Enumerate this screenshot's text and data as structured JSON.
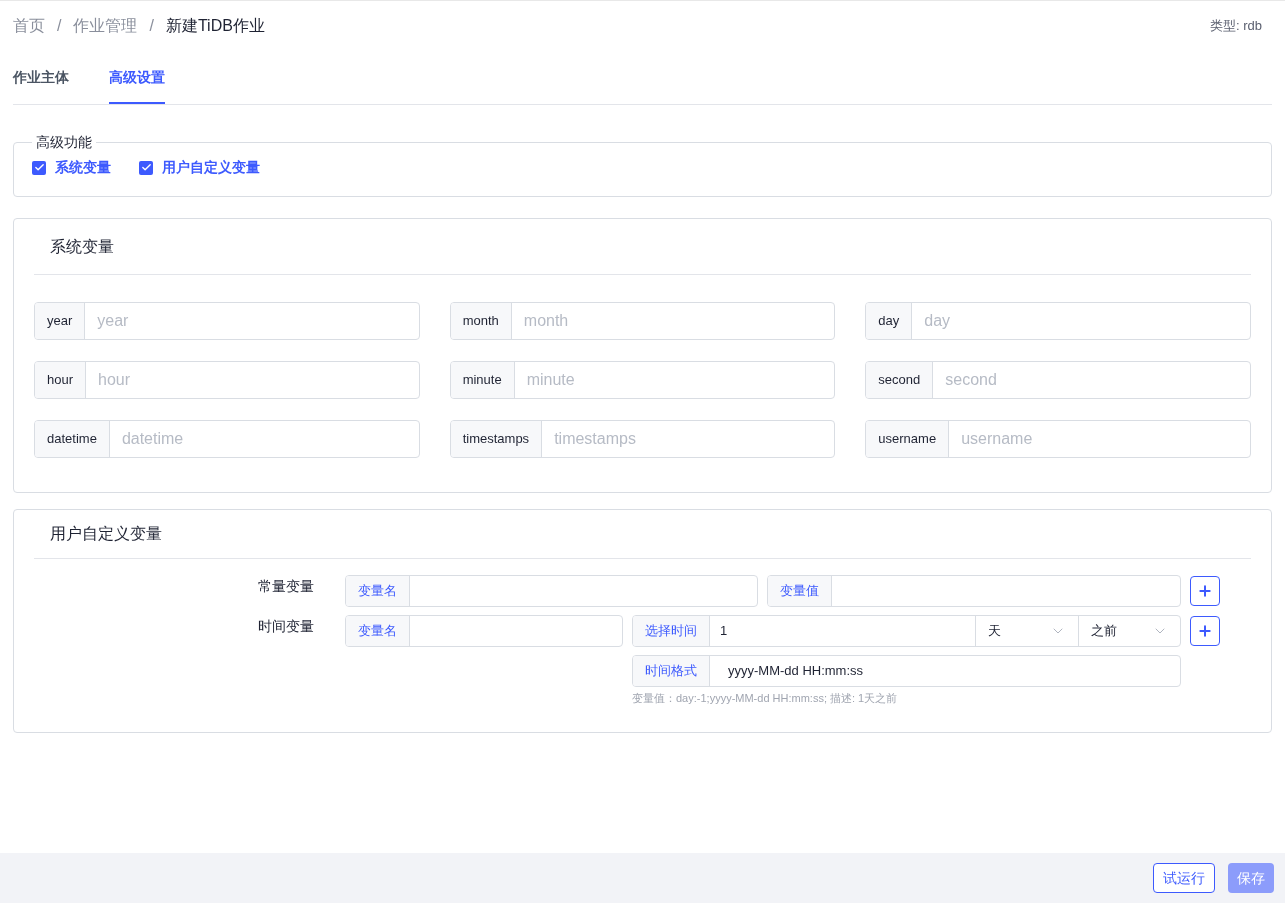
{
  "breadcrumb": [
    {
      "label": "首页",
      "current": false
    },
    {
      "label": "作业管理",
      "current": false
    },
    {
      "label": "新建TiDB作业",
      "current": true
    }
  ],
  "breadcrumb_separator": "/",
  "type_label": "类型: rdb",
  "tabs": [
    {
      "label": "作业主体",
      "selected": false
    },
    {
      "label": "高级设置",
      "selected": true
    }
  ],
  "advanced": {
    "legend": "高级功能",
    "options": [
      {
        "label": "系统变量",
        "checked": true
      },
      {
        "label": "用户自定义变量",
        "checked": true
      }
    ]
  },
  "system_vars": {
    "title": "系统变量",
    "fields": [
      {
        "label": "year",
        "placeholder": "year"
      },
      {
        "label": "month",
        "placeholder": "month"
      },
      {
        "label": "day",
        "placeholder": "day"
      },
      {
        "label": "hour",
        "placeholder": "hour"
      },
      {
        "label": "minute",
        "placeholder": "minute"
      },
      {
        "label": "second",
        "placeholder": "second"
      },
      {
        "label": "datetime",
        "placeholder": "datetime"
      },
      {
        "label": "timestamps",
        "placeholder": "timestamps"
      },
      {
        "label": "username",
        "placeholder": "username"
      }
    ]
  },
  "user_vars": {
    "title": "用户自定义变量",
    "constant": {
      "label": "常量变量",
      "name_prefix": "变量名",
      "value_prefix": "变量值"
    },
    "time": {
      "label": "时间变量",
      "name_prefix": "变量名",
      "time_prefix": "选择时间",
      "time_value": "1",
      "unit": "天",
      "direction": "之前",
      "format_prefix": "时间格式",
      "format_value": "yyyy-MM-dd HH:mm:ss",
      "hint": "变量值：day:-1;yyyy-MM-dd HH:mm:ss; 描述: 1天之前"
    }
  },
  "footer_buttons": [
    {
      "label": "试运行",
      "kind": "outline",
      "disabled": false
    },
    {
      "label": "保存",
      "kind": "primary",
      "disabled": true
    }
  ]
}
